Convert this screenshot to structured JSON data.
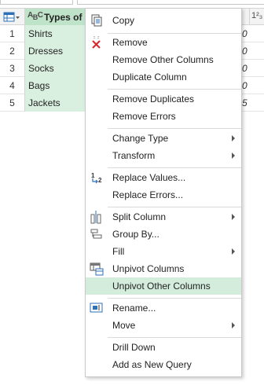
{
  "grid": {
    "column_header": "Types of U",
    "column_type_abbr": "A",
    "column_type_sub": "B C",
    "second_column_type": "1²₃",
    "partial_value": "0",
    "rows": [
      {
        "num": "1",
        "value": "Shirts",
        "tail": "0"
      },
      {
        "num": "2",
        "value": "Dresses",
        "tail": "0"
      },
      {
        "num": "3",
        "value": "Socks",
        "tail": "0"
      },
      {
        "num": "4",
        "value": "Bags",
        "tail": "0"
      },
      {
        "num": "5",
        "value": "Jackets",
        "tail": "5"
      }
    ]
  },
  "menu": {
    "copy": "Copy",
    "remove": "Remove",
    "remove_other_columns": "Remove Other Columns",
    "duplicate_column": "Duplicate Column",
    "remove_duplicates": "Remove Duplicates",
    "remove_errors": "Remove Errors",
    "change_type": "Change Type",
    "transform": "Transform",
    "replace_values": "Replace Values...",
    "replace_errors": "Replace Errors...",
    "split_column": "Split Column",
    "group_by": "Group By...",
    "fill": "Fill",
    "unpivot_columns": "Unpivot Columns",
    "unpivot_other_columns": "Unpivot Other Columns",
    "rename": "Rename...",
    "move": "Move",
    "drill_down": "Drill Down",
    "add_as_new_query": "Add as New Query",
    "highlighted_item": "unpivot_other_columns"
  },
  "colors": {
    "column_header_bg": "#bfe3c8",
    "cell_bg": "#d9efdf",
    "menu_highlight": "#d3ecdc",
    "remove_icon": "#d9272e",
    "icon_blue": "#2e70b8"
  }
}
